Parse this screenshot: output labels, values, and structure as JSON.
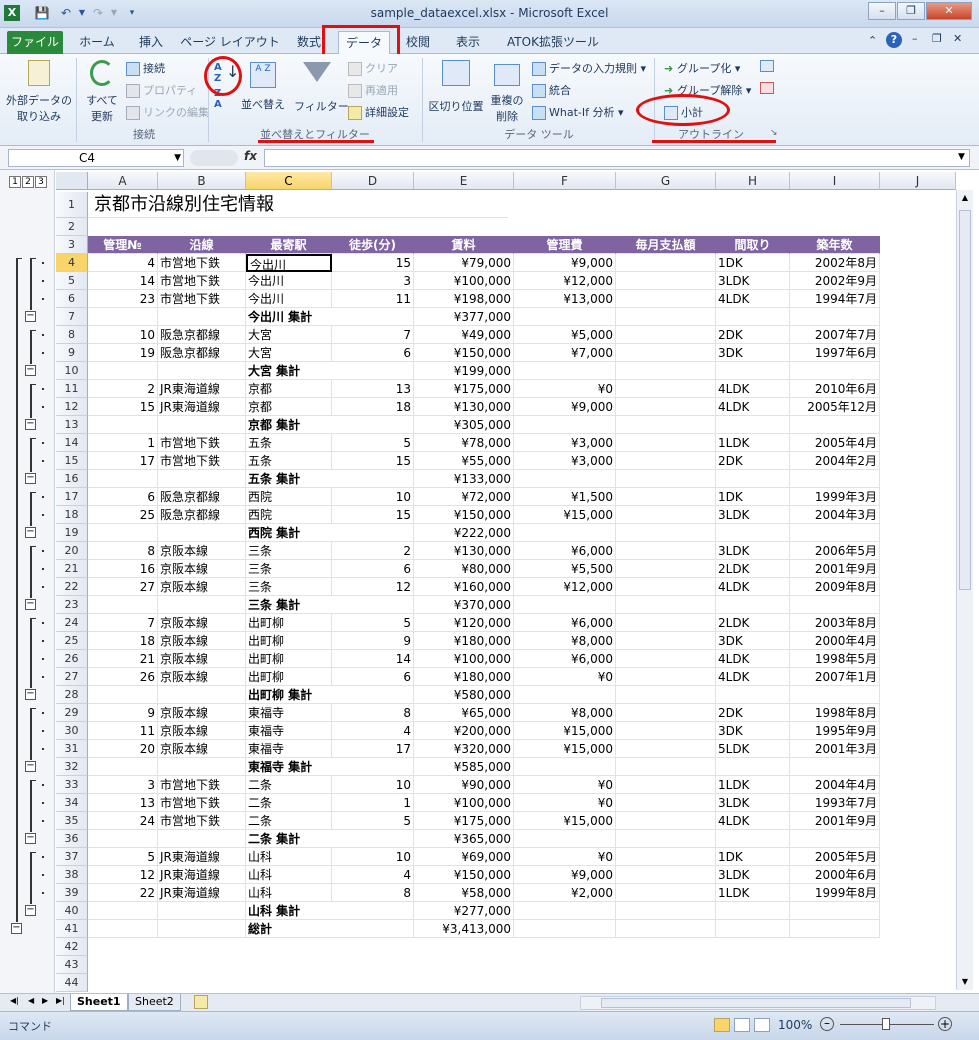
{
  "window": {
    "title": "sample_dataexcel.xlsx - Microsoft Excel"
  },
  "tabs": [
    "ファイル",
    "ホーム",
    "挿入",
    "ページ レイアウト",
    "数式",
    "データ",
    "校閲",
    "表示",
    "ATOK拡張ツール"
  ],
  "ribbon": {
    "get_external": "外部データの取り込み",
    "get_external_l1": "外部データの",
    "get_external_l2": "取り込み",
    "refresh_l1": "すべて",
    "refresh_l2": "更新",
    "connections": "接続",
    "properties": "プロパティ",
    "edit_links": "リンクの編集",
    "grp_connections": "接続",
    "sort": "並べ替え",
    "filter": "フィルター",
    "clear": "クリア",
    "reapply": "再適用",
    "advanced": "詳細設定",
    "grp_sort": "並べ替えとフィルター",
    "text_to_columns": "区切り位置",
    "remove_dup_l1": "重複の",
    "remove_dup_l2": "削除",
    "validation": "データの入力規則",
    "consolidate": "統合",
    "whatif": "What-If 分析",
    "grp_tools": "データ ツール",
    "group": "グループ化",
    "ungroup": "グループ解除",
    "subtotal": "小計",
    "grp_outline": "アウトライン"
  },
  "formula_bar": {
    "name_box": "C4",
    "fx": "fx",
    "formula": ""
  },
  "outline_levels": [
    "1",
    "2",
    "3"
  ],
  "columns": [
    "A",
    "B",
    "C",
    "D",
    "E",
    "F",
    "G",
    "H",
    "I",
    "J"
  ],
  "sheet": {
    "title": "京都市沿線別住宅情報",
    "headers": [
      "管理№",
      "沿線",
      "最寄駅",
      "徒歩(分)",
      "賃料",
      "管理費",
      "毎月支払額",
      "間取り",
      "築年数"
    ],
    "rows": [
      {
        "n": "4",
        "a": "4",
        "b": "市営地下鉄",
        "c": "今出川",
        "d": "15",
        "e": "¥79,000",
        "f": "¥9,000",
        "g": "",
        "h": "1DK",
        "i": "2002年8月"
      },
      {
        "n": "5",
        "a": "14",
        "b": "市営地下鉄",
        "c": "今出川",
        "d": "3",
        "e": "¥100,000",
        "f": "¥12,000",
        "g": "",
        "h": "3LDK",
        "i": "2002年9月"
      },
      {
        "n": "6",
        "a": "23",
        "b": "市営地下鉄",
        "c": "今出川",
        "d": "11",
        "e": "¥198,000",
        "f": "¥13,000",
        "g": "",
        "h": "4LDK",
        "i": "1994年7月"
      },
      {
        "n": "7",
        "a": "",
        "b": "",
        "c": "今出川 集計",
        "d": "",
        "e": "¥377,000",
        "f": "",
        "g": "",
        "h": "",
        "i": "",
        "sub": true
      },
      {
        "n": "8",
        "a": "10",
        "b": "阪急京都線",
        "c": "大宮",
        "d": "7",
        "e": "¥49,000",
        "f": "¥5,000",
        "g": "",
        "h": "2DK",
        "i": "2007年7月"
      },
      {
        "n": "9",
        "a": "19",
        "b": "阪急京都線",
        "c": "大宮",
        "d": "6",
        "e": "¥150,000",
        "f": "¥7,000",
        "g": "",
        "h": "3DK",
        "i": "1997年6月"
      },
      {
        "n": "10",
        "a": "",
        "b": "",
        "c": "大宮 集計",
        "d": "",
        "e": "¥199,000",
        "f": "",
        "g": "",
        "h": "",
        "i": "",
        "sub": true
      },
      {
        "n": "11",
        "a": "2",
        "b": "JR東海道線",
        "c": "京都",
        "d": "13",
        "e": "¥175,000",
        "f": "¥0",
        "g": "",
        "h": "4LDK",
        "i": "2010年6月"
      },
      {
        "n": "12",
        "a": "15",
        "b": "JR東海道線",
        "c": "京都",
        "d": "18",
        "e": "¥130,000",
        "f": "¥9,000",
        "g": "",
        "h": "4LDK",
        "i": "2005年12月"
      },
      {
        "n": "13",
        "a": "",
        "b": "",
        "c": "京都 集計",
        "d": "",
        "e": "¥305,000",
        "f": "",
        "g": "",
        "h": "",
        "i": "",
        "sub": true
      },
      {
        "n": "14",
        "a": "1",
        "b": "市営地下鉄",
        "c": "五条",
        "d": "5",
        "e": "¥78,000",
        "f": "¥3,000",
        "g": "",
        "h": "1LDK",
        "i": "2005年4月"
      },
      {
        "n": "15",
        "a": "17",
        "b": "市営地下鉄",
        "c": "五条",
        "d": "15",
        "e": "¥55,000",
        "f": "¥3,000",
        "g": "",
        "h": "2DK",
        "i": "2004年2月"
      },
      {
        "n": "16",
        "a": "",
        "b": "",
        "c": "五条 集計",
        "d": "",
        "e": "¥133,000",
        "f": "",
        "g": "",
        "h": "",
        "i": "",
        "sub": true
      },
      {
        "n": "17",
        "a": "6",
        "b": "阪急京都線",
        "c": "西院",
        "d": "10",
        "e": "¥72,000",
        "f": "¥1,500",
        "g": "",
        "h": "1DK",
        "i": "1999年3月"
      },
      {
        "n": "18",
        "a": "25",
        "b": "阪急京都線",
        "c": "西院",
        "d": "15",
        "e": "¥150,000",
        "f": "¥15,000",
        "g": "",
        "h": "3LDK",
        "i": "2004年3月"
      },
      {
        "n": "19",
        "a": "",
        "b": "",
        "c": "西院 集計",
        "d": "",
        "e": "¥222,000",
        "f": "",
        "g": "",
        "h": "",
        "i": "",
        "sub": true
      },
      {
        "n": "20",
        "a": "8",
        "b": "京阪本線",
        "c": "三条",
        "d": "2",
        "e": "¥130,000",
        "f": "¥6,000",
        "g": "",
        "h": "3LDK",
        "i": "2006年5月"
      },
      {
        "n": "21",
        "a": "16",
        "b": "京阪本線",
        "c": "三条",
        "d": "6",
        "e": "¥80,000",
        "f": "¥5,500",
        "g": "",
        "h": "2LDK",
        "i": "2001年9月"
      },
      {
        "n": "22",
        "a": "27",
        "b": "京阪本線",
        "c": "三条",
        "d": "12",
        "e": "¥160,000",
        "f": "¥12,000",
        "g": "",
        "h": "4LDK",
        "i": "2009年8月"
      },
      {
        "n": "23",
        "a": "",
        "b": "",
        "c": "三条 集計",
        "d": "",
        "e": "¥370,000",
        "f": "",
        "g": "",
        "h": "",
        "i": "",
        "sub": true
      },
      {
        "n": "24",
        "a": "7",
        "b": "京阪本線",
        "c": "出町柳",
        "d": "5",
        "e": "¥120,000",
        "f": "¥6,000",
        "g": "",
        "h": "2LDK",
        "i": "2003年8月"
      },
      {
        "n": "25",
        "a": "18",
        "b": "京阪本線",
        "c": "出町柳",
        "d": "9",
        "e": "¥180,000",
        "f": "¥8,000",
        "g": "",
        "h": "3DK",
        "i": "2000年4月"
      },
      {
        "n": "26",
        "a": "21",
        "b": "京阪本線",
        "c": "出町柳",
        "d": "14",
        "e": "¥100,000",
        "f": "¥6,000",
        "g": "",
        "h": "4LDK",
        "i": "1998年5月"
      },
      {
        "n": "27",
        "a": "26",
        "b": "京阪本線",
        "c": "出町柳",
        "d": "6",
        "e": "¥180,000",
        "f": "¥0",
        "g": "",
        "h": "4LDK",
        "i": "2007年1月"
      },
      {
        "n": "28",
        "a": "",
        "b": "",
        "c": "出町柳 集計",
        "d": "",
        "e": "¥580,000",
        "f": "",
        "g": "",
        "h": "",
        "i": "",
        "sub": true
      },
      {
        "n": "29",
        "a": "9",
        "b": "京阪本線",
        "c": "東福寺",
        "d": "8",
        "e": "¥65,000",
        "f": "¥8,000",
        "g": "",
        "h": "2DK",
        "i": "1998年8月"
      },
      {
        "n": "30",
        "a": "11",
        "b": "京阪本線",
        "c": "東福寺",
        "d": "4",
        "e": "¥200,000",
        "f": "¥15,000",
        "g": "",
        "h": "3DK",
        "i": "1995年9月"
      },
      {
        "n": "31",
        "a": "20",
        "b": "京阪本線",
        "c": "東福寺",
        "d": "17",
        "e": "¥320,000",
        "f": "¥15,000",
        "g": "",
        "h": "5LDK",
        "i": "2001年3月"
      },
      {
        "n": "32",
        "a": "",
        "b": "",
        "c": "東福寺 集計",
        "d": "",
        "e": "¥585,000",
        "f": "",
        "g": "",
        "h": "",
        "i": "",
        "sub": true
      },
      {
        "n": "33",
        "a": "3",
        "b": "市営地下鉄",
        "c": "二条",
        "d": "10",
        "e": "¥90,000",
        "f": "¥0",
        "g": "",
        "h": "1LDK",
        "i": "2004年4月"
      },
      {
        "n": "34",
        "a": "13",
        "b": "市営地下鉄",
        "c": "二条",
        "d": "1",
        "e": "¥100,000",
        "f": "¥0",
        "g": "",
        "h": "3LDK",
        "i": "1993年7月"
      },
      {
        "n": "35",
        "a": "24",
        "b": "市営地下鉄",
        "c": "二条",
        "d": "5",
        "e": "¥175,000",
        "f": "¥15,000",
        "g": "",
        "h": "4LDK",
        "i": "2001年9月"
      },
      {
        "n": "36",
        "a": "",
        "b": "",
        "c": "二条 集計",
        "d": "",
        "e": "¥365,000",
        "f": "",
        "g": "",
        "h": "",
        "i": "",
        "sub": true
      },
      {
        "n": "37",
        "a": "5",
        "b": "JR東海道線",
        "c": "山科",
        "d": "10",
        "e": "¥69,000",
        "f": "¥0",
        "g": "",
        "h": "1DK",
        "i": "2005年5月"
      },
      {
        "n": "38",
        "a": "12",
        "b": "JR東海道線",
        "c": "山科",
        "d": "4",
        "e": "¥150,000",
        "f": "¥9,000",
        "g": "",
        "h": "3LDK",
        "i": "2000年6月"
      },
      {
        "n": "39",
        "a": "22",
        "b": "JR東海道線",
        "c": "山科",
        "d": "8",
        "e": "¥58,000",
        "f": "¥2,000",
        "g": "",
        "h": "1LDK",
        "i": "1999年8月"
      },
      {
        "n": "40",
        "a": "",
        "b": "",
        "c": "山科 集計",
        "d": "",
        "e": "¥277,000",
        "f": "",
        "g": "",
        "h": "",
        "i": "",
        "sub": true
      },
      {
        "n": "41",
        "a": "",
        "b": "",
        "c": "総計",
        "d": "",
        "e": "¥3,413,000",
        "f": "",
        "g": "",
        "h": "",
        "i": "",
        "sub": true
      }
    ],
    "empty_rows": [
      "42",
      "43",
      "44"
    ]
  },
  "sheet_tabs": [
    "Sheet1",
    "Sheet2"
  ],
  "status": {
    "mode": "コマンド",
    "zoom": "100%"
  },
  "colors": {
    "header_purple": "#8064a2",
    "annotation_red": "#e01010",
    "file_tab_green": "#2a8a3b"
  }
}
